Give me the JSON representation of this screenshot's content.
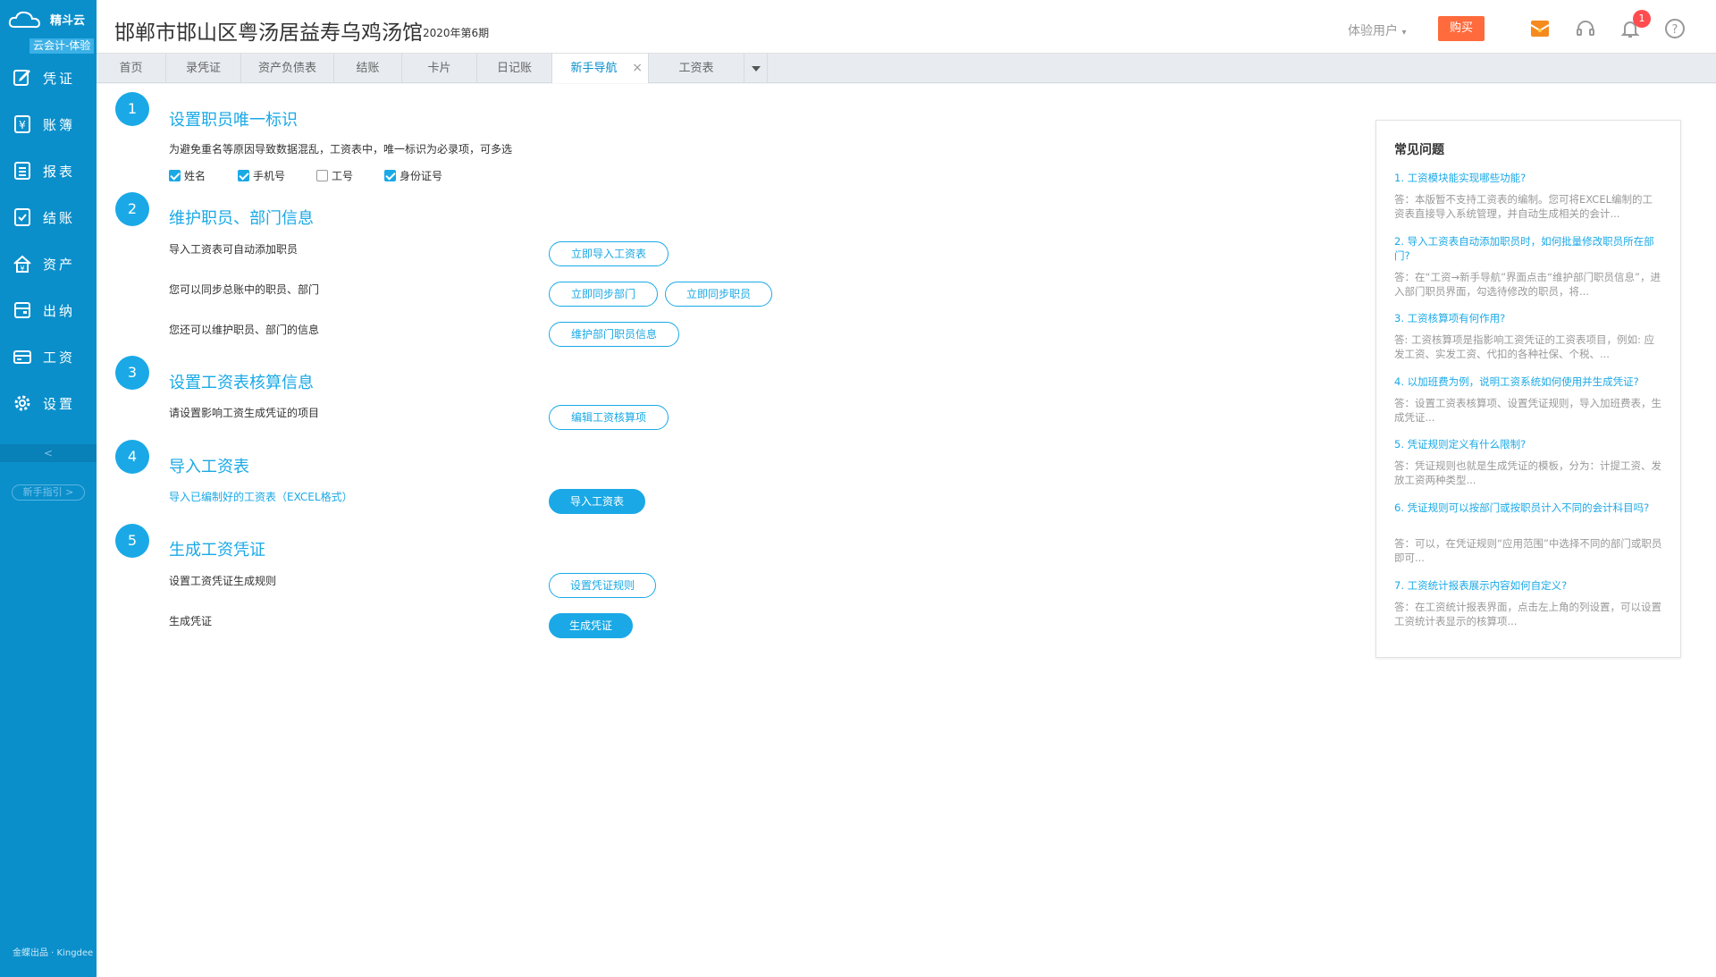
{
  "sidebar": {
    "logo_text": "精斗云",
    "logo_sub": "云会计-体验",
    "items": [
      {
        "label": "凭证",
        "icon": "edit-icon"
      },
      {
        "label": "账簿",
        "icon": "ledger-icon"
      },
      {
        "label": "报表",
        "icon": "report-icon"
      },
      {
        "label": "结账",
        "icon": "checkout-icon"
      },
      {
        "label": "资产",
        "icon": "asset-icon"
      },
      {
        "label": "出纳",
        "icon": "cashier-icon"
      },
      {
        "label": "工资",
        "icon": "salary-icon"
      },
      {
        "label": "设置",
        "icon": "gear-icon"
      }
    ],
    "collapse": "<",
    "newbie_button": "新手指引 >",
    "footer": "金蝶出品 · Kingdee"
  },
  "header": {
    "company": "邯郸市邯山区粤汤居益寿乌鸡汤馆",
    "period": "2020年第6期",
    "user": "体验用户",
    "buy": "购买",
    "notification_count": "1",
    "colors": {
      "buy": "#ff6b3d",
      "badge": "#ff4d4f",
      "brand": "#0a8fcb",
      "accent": "#1aa9e6"
    }
  },
  "tabs": [
    {
      "label": "首页"
    },
    {
      "label": "录凭证"
    },
    {
      "label": "资产负债表"
    },
    {
      "label": "结账"
    },
    {
      "label": "卡片"
    },
    {
      "label": "日记账"
    },
    {
      "label": "新手导航",
      "active": true,
      "close": "×"
    },
    {
      "label": "工资表"
    }
  ],
  "steps": [
    {
      "num": "1",
      "title": "设置职员唯一标识",
      "desc": "为避免重名等原因导致数据混乱，工资表中，唯一标识为必录项，可多选",
      "checkboxes": [
        {
          "label": "姓名",
          "checked": true
        },
        {
          "label": "手机号",
          "checked": true
        },
        {
          "label": "工号",
          "checked": false
        },
        {
          "label": "身份证号",
          "checked": true
        }
      ]
    },
    {
      "num": "2",
      "title": "维护职员、部门信息",
      "rows": [
        {
          "text": "导入工资表可自动添加职员",
          "buttons": [
            "立即导入工资表"
          ]
        },
        {
          "text": "您可以同步总账中的职员、部门",
          "buttons": [
            "立即同步部门",
            "立即同步职员"
          ]
        },
        {
          "text": "您还可以维护职员、部门的信息",
          "buttons": [
            "维护部门职员信息"
          ]
        }
      ]
    },
    {
      "num": "3",
      "title": "设置工资表核算信息",
      "rows": [
        {
          "text": "请设置影响工资生成凭证的项目",
          "buttons": [
            "编辑工资核算项"
          ]
        }
      ]
    },
    {
      "num": "4",
      "title": "导入工资表",
      "rows": [
        {
          "text": "导入已编制好的工资表（EXCEL格式）",
          "buttons": [
            "导入工资表"
          ]
        }
      ]
    },
    {
      "num": "5",
      "title": "生成工资凭证",
      "rows": [
        {
          "text": "设置工资凭证生成规则",
          "buttons": [
            "设置凭证规则"
          ]
        },
        {
          "text": "生成凭证",
          "buttons": [
            "生成凭证"
          ]
        }
      ]
    }
  ],
  "faq": {
    "title": "常见问题",
    "items": [
      {
        "q": "1. 工资模块能实现哪些功能?",
        "a": "答：本版暂不支持工资表的编制。您可将EXCEL编制的工资表直接导入系统管理，并自动生成相关的会计..."
      },
      {
        "q": "2. 导入工资表自动添加职员时，如何批量修改职员所在部门?",
        "a": "答：在“工资→新手导航”界面点击“维护部门职员信息”，进入部门职员界面，勾选待修改的职员，将..."
      },
      {
        "q": "3. 工资核算项有何作用?",
        "a": "答: 工资核算项是指影响工资凭证的工资表项目，例如: 应发工资、实发工资、代扣的各种社保、个税、..."
      },
      {
        "q": "4. 以加班费为例，说明工资系统如何使用并生成凭证?",
        "a": "答：设置工资表核算项、设置凭证规则，导入加班费表，生成凭证..."
      },
      {
        "q": "5. 凭证规则定义有什么限制?",
        "a": "答：凭证规则也就是生成凭证的模板，分为：计提工资、发放工资两种类型..."
      },
      {
        "q": "6. 凭证规则可以按部门或按职员计入不同的会计科目吗?",
        "a": "答：可以，在凭证规则“应用范围”中选择不同的部门或职员即可..."
      },
      {
        "q": "7. 工资统计报表展示内容如何自定义?",
        "a": "答：在工资统计报表界面，点击左上角的列设置，可以设置工资统计表显示的核算项..."
      }
    ]
  }
}
